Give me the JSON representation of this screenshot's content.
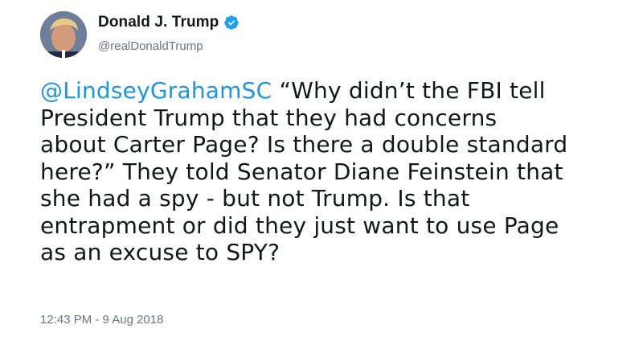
{
  "user": {
    "display_name": "Donald J. Trump",
    "handle": "@realDonaldTrump",
    "verified": true
  },
  "tweet": {
    "mention": "@LindseyGrahamSC",
    "body": "  “Why didn’t the FBI tell\nPresident Trump that they had concerns\nabout Carter Page? Is there a double standard\nhere?” They told Senator Diane Feinstein that\nshe had a spy - but not Trump. Is that\nentrapment or did they just want to use Page\nas an excuse to SPY?",
    "timestamp": "12:43 PM - 9 Aug 2018"
  },
  "colors": {
    "link": "#1b95e0",
    "secondary_text": "#657786",
    "verified_badge": "#1da1f2"
  },
  "icons": {
    "verified": "verified-badge-icon",
    "avatar": "profile-photo"
  }
}
